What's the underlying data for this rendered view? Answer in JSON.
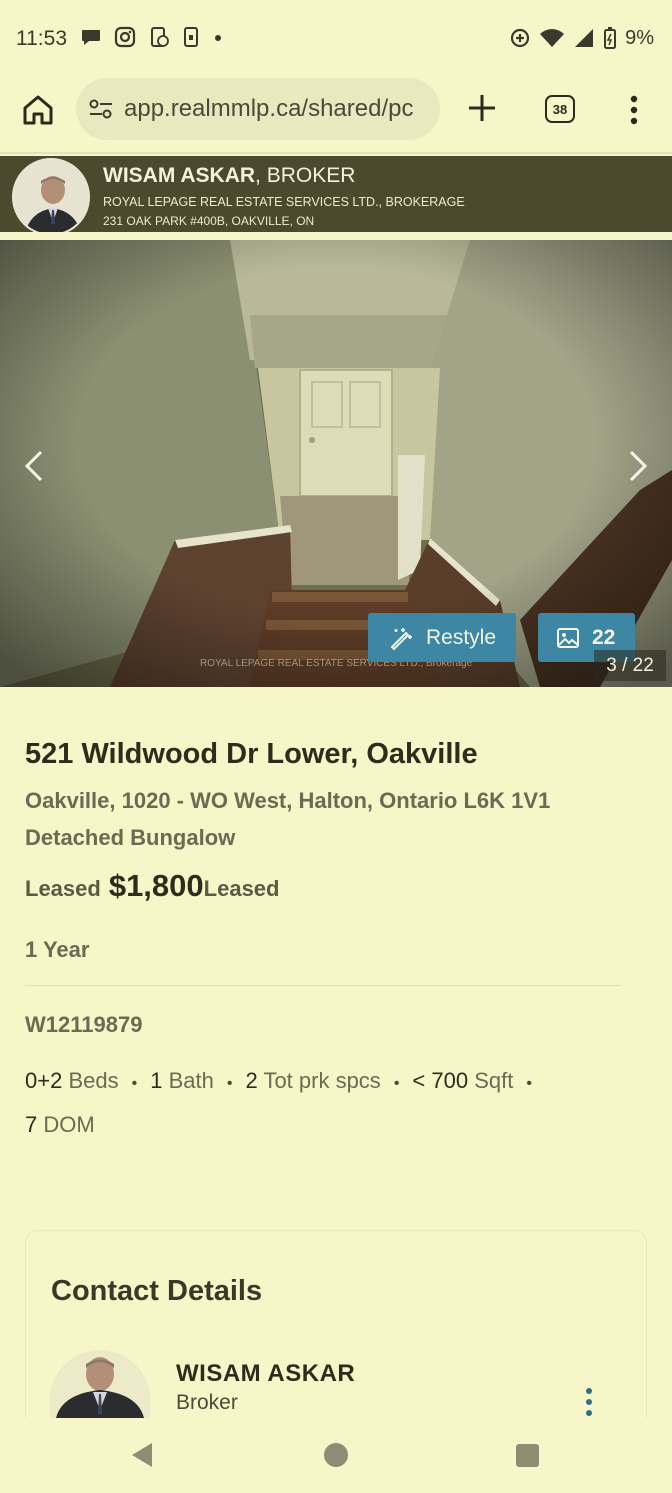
{
  "status_bar": {
    "time": "11:53",
    "battery": "9%",
    "left_icons": [
      "chat-bubble-icon",
      "instagram-icon",
      "phone-sync-icon",
      "sim-icon",
      "dot-icon"
    ],
    "right_icons": [
      "data-saver-icon",
      "wifi-icon",
      "signal-icon",
      "battery-icon"
    ]
  },
  "browser": {
    "url": "app.realmmlp.ca/shared/pc",
    "tab_count": "38"
  },
  "agent_banner": {
    "name": "WISAM ASKAR",
    "title": ", BROKER",
    "brokerage": "ROYAL LEPAGE REAL ESTATE SERVICES LTD., BROKERAGE",
    "address": "231 OAK PARK #400B, OAKVILLE, ON"
  },
  "gallery": {
    "restyle_label": "Restyle",
    "photo_count": "22",
    "counter": "3 / 22",
    "watermark": "ROYAL LEPAGE REAL ESTATE SERVICES LTD., Brokerage"
  },
  "listing": {
    "address": "521 Wildwood Dr Lower, Oakville",
    "area": "Oakville, 1020 - WO West, Halton, Ontario L6K 1V1",
    "type": "Detached Bungalow",
    "price_label": "Leased",
    "price": "$1,800",
    "price_status": "Leased",
    "term": "1 Year",
    "mls": "W12119879",
    "facts": {
      "beds_num": "0+2",
      "beds_unit": "Beds",
      "bath_num": "1",
      "bath_unit": "Bath",
      "parking_num": "2",
      "parking_unit": "Tot prk spcs",
      "sqft_num": "< 700",
      "sqft_unit": "Sqft",
      "dom_num": "7",
      "dom_unit": "DOM"
    }
  },
  "contact": {
    "heading": "Contact Details",
    "name": "WISAM ASKAR",
    "role": "Broker"
  },
  "colors": {
    "background": "#f6f6c8",
    "banner": "#4c4a2e",
    "accent_button": "#3e87a4"
  }
}
